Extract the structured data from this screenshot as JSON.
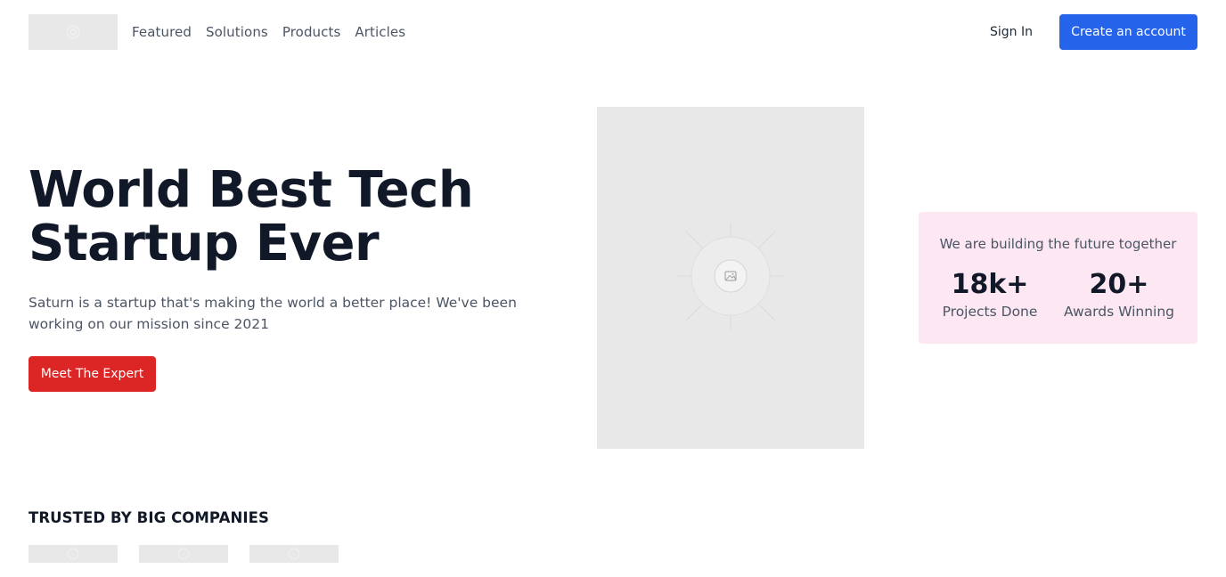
{
  "header": {
    "logo_icon": "image-placeholder-icon",
    "nav": [
      "Featured",
      "Solutions",
      "Products",
      "Articles"
    ],
    "sign_in_label": "Sign In",
    "create_account_label": "Create an account"
  },
  "hero": {
    "title_line1": "World Best Tech",
    "title_line2": "Startup Ever",
    "description": "Saturn is a startup that's making the world a better place! We've been working on our mission since 2021",
    "cta_label": "Meet The Expert",
    "image_icon": "image-placeholder-icon"
  },
  "stats": {
    "caption": "We are building the future together",
    "items": [
      {
        "value": "18k+",
        "label": "Projects Done"
      },
      {
        "value": "20+",
        "label": "Awards Winning"
      }
    ]
  },
  "trusted": {
    "title": "TRUSTED BY BIG COMPANIES",
    "logo_count": 3
  },
  "colors": {
    "primary_blue": "#2563eb",
    "cta_red": "#dc2626",
    "stats_bg": "#fce7f3",
    "placeholder_gray": "#e8e8e8",
    "heading": "#111827",
    "body_text": "#4b5563"
  }
}
